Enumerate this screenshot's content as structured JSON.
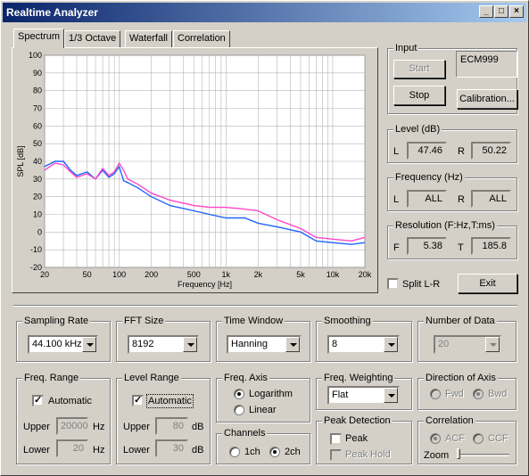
{
  "window": {
    "title": "Realtime Analyzer"
  },
  "tabs": [
    "Spectrum",
    "1/3 Octave",
    "Waterfall",
    "Correlation"
  ],
  "chart_data": {
    "type": "line",
    "ylabel": "SPL [dB]",
    "xlabel": "Frequency [Hz]",
    "xscale": "log",
    "xlim": [
      20,
      20000
    ],
    "ylim": [
      -20,
      100
    ],
    "xticks": [
      "20",
      "50",
      "100",
      "200",
      "500",
      "1k",
      "2k",
      "5k",
      "10k",
      "20k"
    ],
    "yticks": [
      "100",
      "90",
      "80",
      "70",
      "60",
      "50",
      "40",
      "30",
      "20",
      "10",
      "0",
      "-10",
      "-20"
    ],
    "grid": true,
    "series": [
      {
        "color": "#1e64ff",
        "x": [
          20,
          25,
          30,
          35,
          40,
          50,
          60,
          70,
          80,
          90,
          100,
          110,
          120,
          150,
          200,
          300,
          500,
          700,
          1000,
          1500,
          2000,
          3000,
          5000,
          7000,
          10000,
          15000,
          20000
        ],
        "y": [
          37,
          40,
          40,
          35,
          32,
          34,
          30,
          35,
          31,
          33,
          37,
          29,
          28,
          25,
          20,
          15,
          12,
          10,
          8,
          8,
          5,
          3,
          0,
          -5,
          -6,
          -7,
          -6
        ]
      },
      {
        "color": "#ff46c8",
        "x": [
          20,
          25,
          30,
          35,
          40,
          50,
          60,
          70,
          80,
          90,
          100,
          110,
          120,
          150,
          200,
          300,
          500,
          700,
          1000,
          1500,
          2000,
          3000,
          5000,
          7000,
          10000,
          15000,
          20000
        ],
        "y": [
          35,
          39,
          38,
          34,
          31,
          33,
          30,
          36,
          32,
          34,
          39,
          35,
          30,
          27,
          22,
          18,
          15,
          14,
          14,
          13,
          12,
          7,
          2,
          -3,
          -4,
          -5,
          -3
        ]
      }
    ]
  },
  "input": {
    "title": "Input",
    "start": "Start",
    "stop": "Stop",
    "device": "ECM999",
    "calibration": "Calibration..."
  },
  "level": {
    "title": "Level (dB)",
    "l_label": "L",
    "l_value": "47.46",
    "r_label": "R",
    "r_value": "50.22"
  },
  "frequency": {
    "title": "Frequency (Hz)",
    "l_label": "L",
    "l_value": "ALL",
    "r_label": "R",
    "r_value": "ALL"
  },
  "resolution": {
    "title": "Resolution (F:Hz,T:ms)",
    "f_label": "F",
    "f_value": "5.38",
    "t_label": "T",
    "t_value": "185.8"
  },
  "split_lr": "Split L-R",
  "exit": "Exit",
  "sampling_rate": {
    "title": "Sampling Rate",
    "value": "44.100 kHz"
  },
  "fft_size": {
    "title": "FFT Size",
    "value": "8192"
  },
  "time_window": {
    "title": "Time Window",
    "value": "Hanning"
  },
  "smoothing": {
    "title": "Smoothing",
    "value": "8"
  },
  "number_of_data": {
    "title": "Number of Data",
    "value": "20"
  },
  "freq_range": {
    "title": "Freq. Range",
    "automatic": "Automatic",
    "upper_label": "Upper",
    "upper_value": "20000",
    "upper_unit": "Hz",
    "lower_label": "Lower",
    "lower_value": "20",
    "lower_unit": "Hz"
  },
  "level_range": {
    "title": "Level Range",
    "automatic": "Automatic",
    "upper_label": "Upper",
    "upper_value": "80",
    "upper_unit": "dB",
    "lower_label": "Lower",
    "lower_value": "30",
    "lower_unit": "dB"
  },
  "freq_axis": {
    "title": "Freq. Axis",
    "logarithm": "Logarithm",
    "linear": "Linear"
  },
  "channels": {
    "title": "Channels",
    "ch1": "1ch",
    "ch2": "2ch"
  },
  "freq_weighting": {
    "title": "Freq. Weighting",
    "value": "Flat"
  },
  "peak_detection": {
    "title": "Peak Detection",
    "peak": "Peak",
    "peak_hold": "Peak Hold"
  },
  "direction_of_axis": {
    "title": "Direction of Axis",
    "fwd": "Fwd",
    "bwd": "Bwd"
  },
  "correlation": {
    "title": "Correlation",
    "acf": "ACF",
    "ccf": "CCF",
    "zoom": "Zoom"
  }
}
